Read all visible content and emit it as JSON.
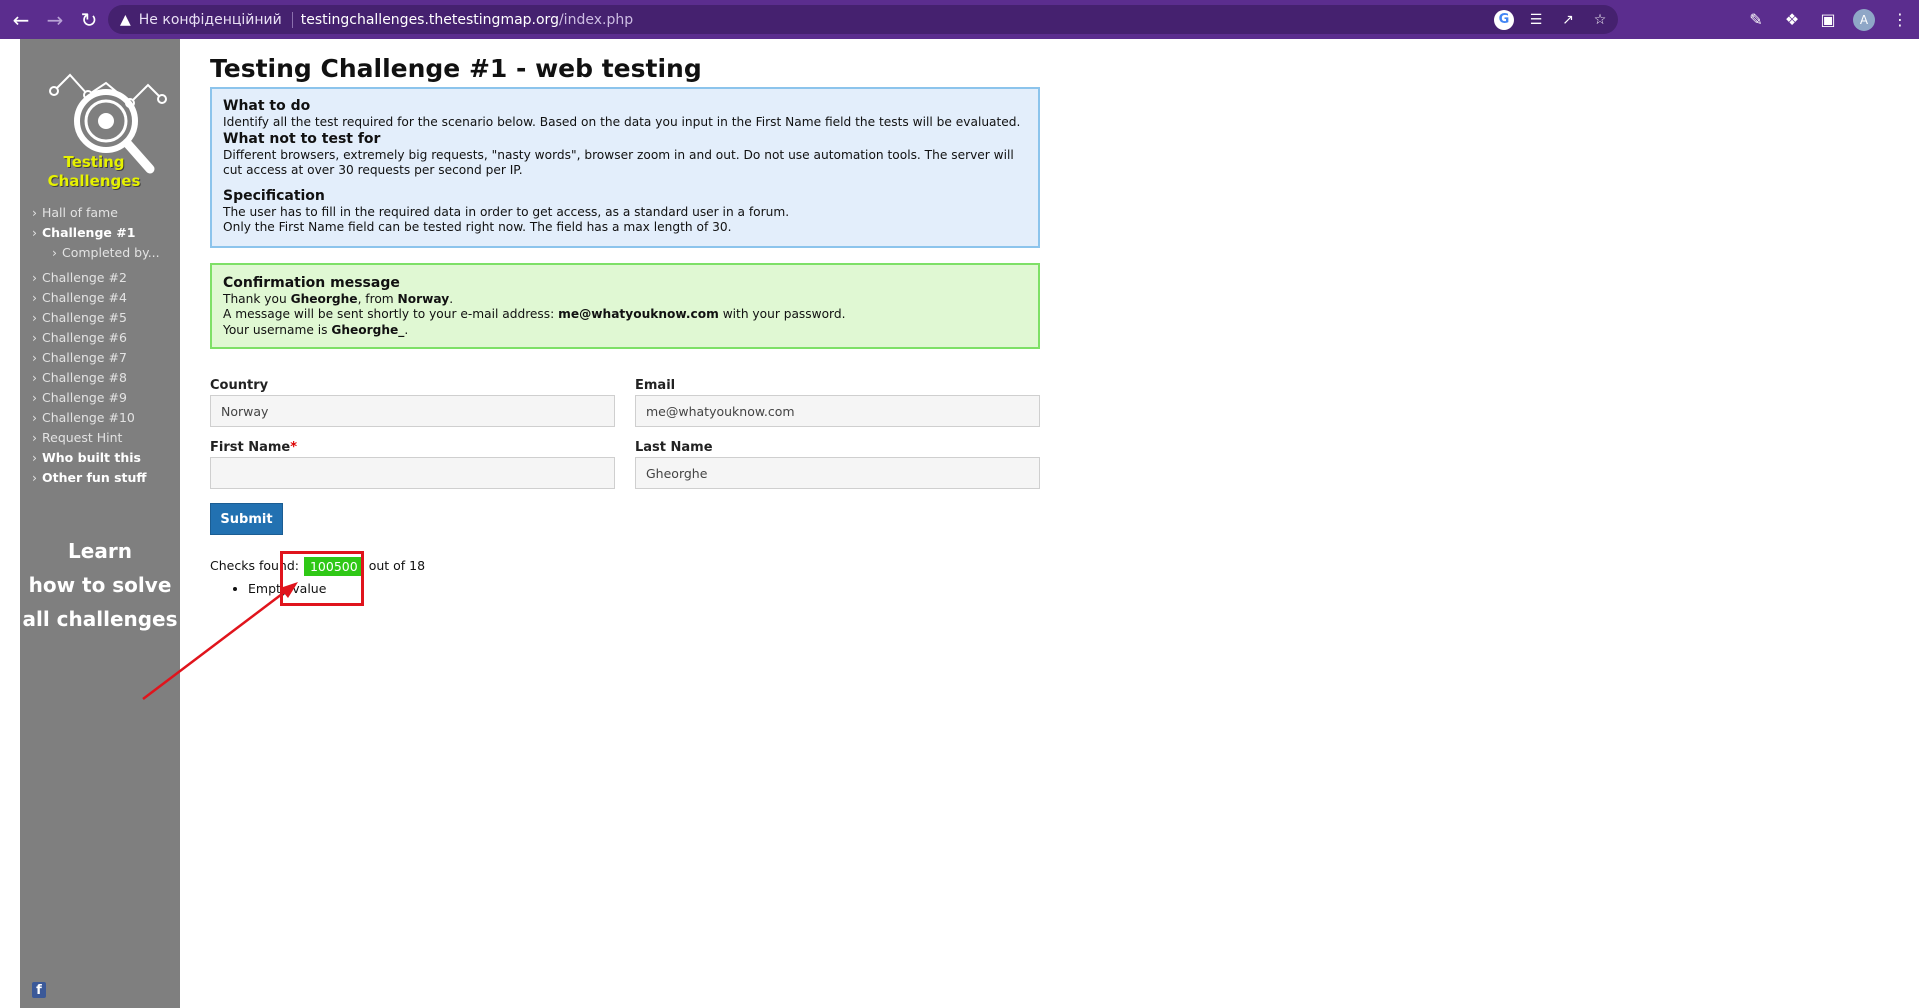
{
  "browser": {
    "security_label": "Не конфіденційний",
    "url_host": "testingchallenges.thetestingmap.org",
    "url_path": "/index.php",
    "avatar_letter": "A"
  },
  "sidebar": {
    "logo_line1": "Testing",
    "logo_line2": "Challenges",
    "items": [
      {
        "label": "Hall of fame"
      },
      {
        "label": "Challenge #1"
      },
      {
        "label": "Completed by..."
      },
      {
        "label": "Challenge #2"
      },
      {
        "label": "Challenge #4"
      },
      {
        "label": "Challenge #5"
      },
      {
        "label": "Challenge #6"
      },
      {
        "label": "Challenge #7"
      },
      {
        "label": "Challenge #8"
      },
      {
        "label": "Challenge #9"
      },
      {
        "label": "Challenge #10"
      },
      {
        "label": "Request Hint"
      },
      {
        "label": "Who built this"
      },
      {
        "label": "Other fun stuff"
      }
    ],
    "learn_line1": "Learn",
    "learn_line2": "how to solve",
    "learn_line3": "all challenges"
  },
  "main": {
    "title": "Testing Challenge #1 - web testing",
    "info": {
      "what_to_do_title": "What to do",
      "what_to_do_text": "Identify all the test required for the scenario below. Based on the data you input in the First Name field the tests will be evaluated.",
      "what_not_title": "What not to test for",
      "what_not_text": "Different browsers, extremely big requests, \"nasty words\", browser zoom in and out. Do not use automation tools. The server will cut access at over 30 requests per second per IP.",
      "spec_title": "Specification",
      "spec_line1": "The user has to fill in the required data in order to get access, as a standard user in a forum.",
      "spec_line2": "Only the First Name field can be tested right now. The field has a max length of 30."
    },
    "confirmation": {
      "title": "Confirmation message",
      "thank_prefix": "Thank you ",
      "name": "Gheorghe",
      "from_text": ", from ",
      "country": "Norway",
      "period": ".",
      "message_prefix": "A message will be sent shortly to your e-mail address: ",
      "email": "me@whatyouknow.com",
      "message_suffix": " with your password.",
      "username_prefix": "Your username is ",
      "username": "Gheorghe_",
      "username_suffix": "."
    },
    "form": {
      "country_label": "Country",
      "country_value": "Norway",
      "email_label": "Email",
      "email_value": "me@whatyouknow.com",
      "first_name_label": "First Name",
      "required_mark": "*",
      "first_name_value": "",
      "last_name_label": "Last Name",
      "last_name_value": "Gheorghe",
      "submit_label": "Submit"
    },
    "checks": {
      "prefix": "Checks found:",
      "count": "100500",
      "suffix": "out of 18",
      "results": [
        "Empty value"
      ]
    }
  },
  "annotation_color": "#e0141c"
}
